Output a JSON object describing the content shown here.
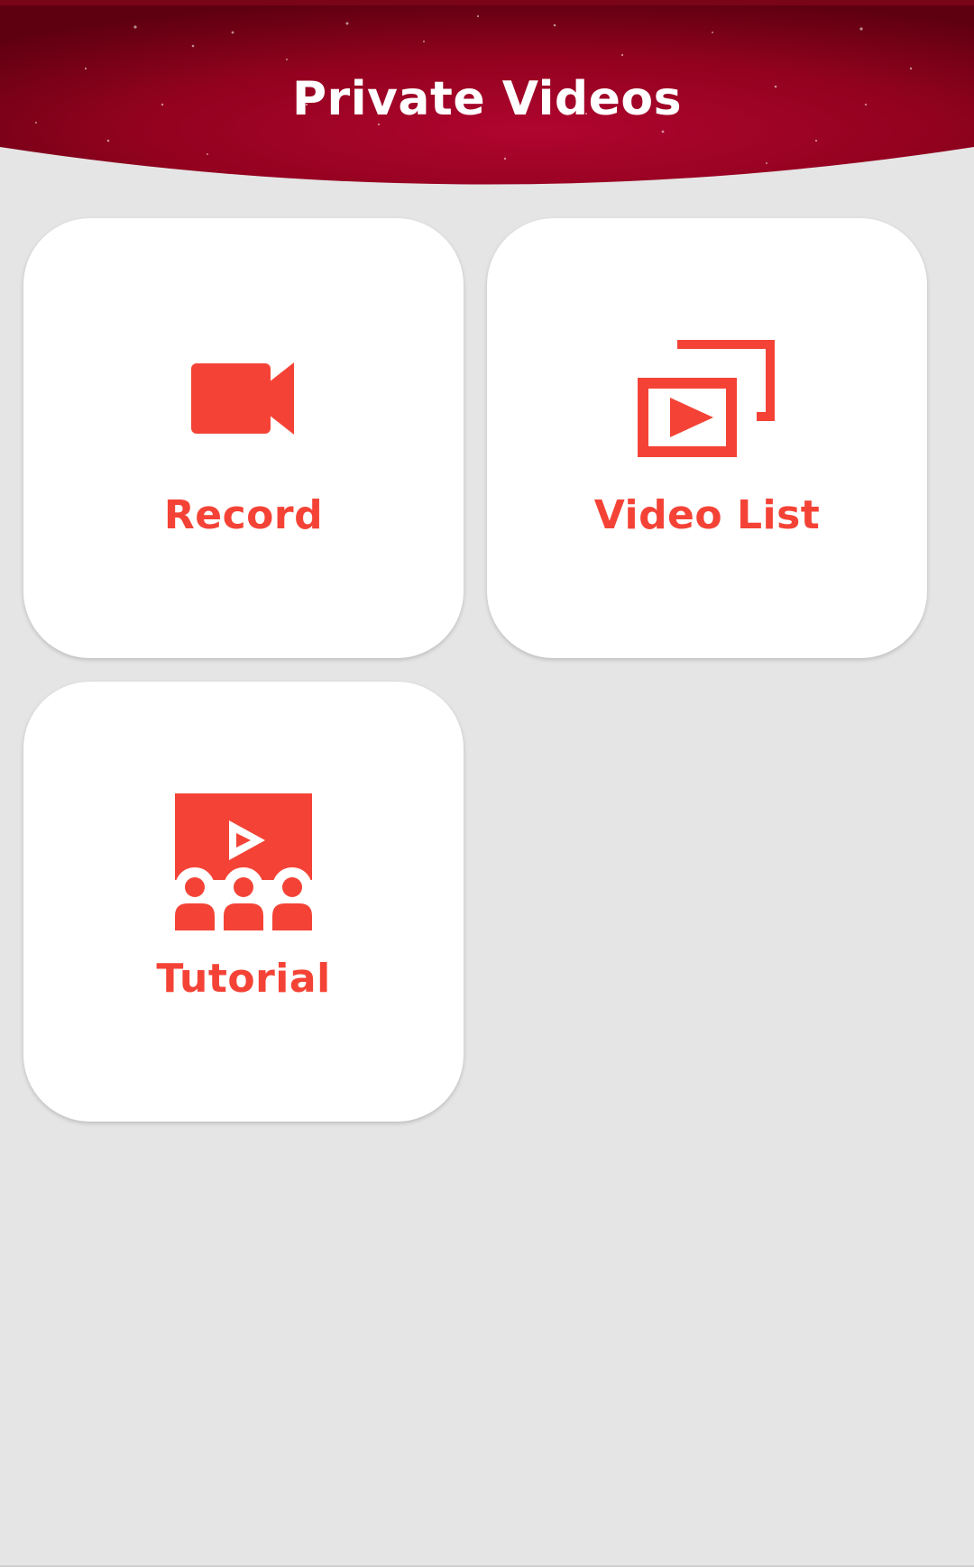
{
  "app": {
    "title": "Private Videos"
  },
  "colors": {
    "accent": "#f44336",
    "header_dark": "#7a0418",
    "header_mid": "#a8022e",
    "background": "#e5e5e5",
    "card": "#ffffff"
  },
  "menu": {
    "items": [
      {
        "label": "Record",
        "icon": "video-camera-icon"
      },
      {
        "label": "Video List",
        "icon": "video-library-icon"
      },
      {
        "label": "Tutorial",
        "icon": "tutorial-audience-icon"
      }
    ]
  }
}
